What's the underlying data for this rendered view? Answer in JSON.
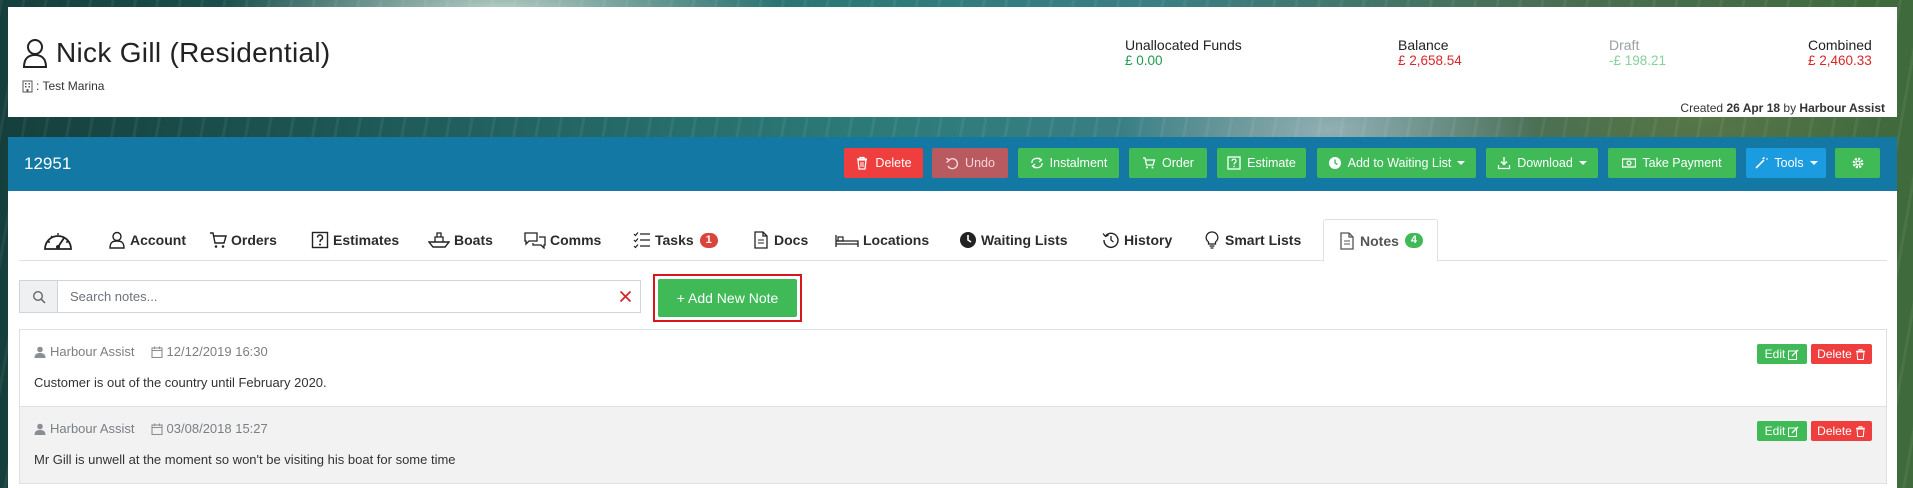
{
  "customer": {
    "name": "Nick Gill (Residential)",
    "marina": ": Test Marina"
  },
  "funds": {
    "unallocated_label": "Unallocated Funds",
    "unallocated_value": "£ 0.00",
    "balance_label": "Balance",
    "balance_value": "£ 2,658.54",
    "draft_label": "Draft",
    "draft_value": "-£ 198.21",
    "combined_label": "Combined",
    "combined_value": "£ 2,460.33"
  },
  "created": {
    "prefix": "Created",
    "date": "26 Apr 18",
    "by": "by",
    "author": "Harbour Assist"
  },
  "toolbar": {
    "record_id": "12951",
    "buttons": {
      "delete": "Delete",
      "undo": "Undo",
      "instalment": "Instalment",
      "order": "Order",
      "estimate": "Estimate",
      "waiting_list": "Add to Waiting List",
      "download": "Download",
      "take_payment": "Take Payment",
      "tools": "Tools"
    }
  },
  "tabs": [
    {
      "label": "",
      "icon": "dashboard-icon"
    },
    {
      "label": "Account",
      "icon": "user-icon"
    },
    {
      "label": "Orders",
      "icon": "cart-icon"
    },
    {
      "label": "Estimates",
      "icon": "question-icon"
    },
    {
      "label": "Boats",
      "icon": "boat-icon"
    },
    {
      "label": "Comms",
      "icon": "comments-icon"
    },
    {
      "label": "Tasks",
      "icon": "tasks-icon",
      "badge": "1"
    },
    {
      "label": "Docs",
      "icon": "document-icon"
    },
    {
      "label": "Locations",
      "icon": "bed-icon"
    },
    {
      "label": "Waiting Lists",
      "icon": "clock-icon"
    },
    {
      "label": "History",
      "icon": "history-icon"
    },
    {
      "label": "Smart Lists",
      "icon": "lightbulb-icon"
    },
    {
      "label": "Notes",
      "icon": "note-icon",
      "badge": "4",
      "active": true
    }
  ],
  "search": {
    "placeholder": "Search notes...",
    "value": ""
  },
  "add_note_label": "+ Add New Note",
  "notes": [
    {
      "author": "Harbour Assist",
      "datetime": "12/12/2019 16:30",
      "text": "Customer is out of the country until February 2020.",
      "edit_label": "Edit",
      "delete_label": "Delete"
    },
    {
      "author": "Harbour Assist",
      "datetime": "03/08/2018 15:27",
      "text": "Mr Gill is unwell at the moment so won't be visiting his boat for some time",
      "edit_label": "Edit",
      "delete_label": "Delete"
    }
  ],
  "colors": {
    "toolbar_blue": "#1378a4",
    "green": "#3fba57",
    "red": "#ee3e3e",
    "highlight": "#d8171c"
  }
}
